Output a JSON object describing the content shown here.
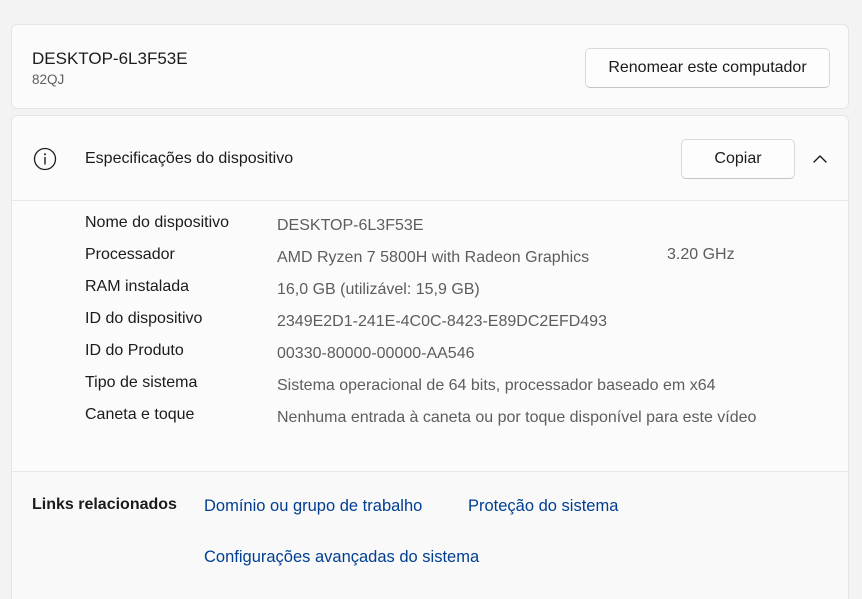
{
  "device": {
    "name": "DESKTOP-6L3F53E",
    "model": "82QJ",
    "rename_label": "Renomear este computador"
  },
  "specs": {
    "title": "Especificações do dispositivo",
    "copy_label": "Copiar",
    "expanded": true,
    "rows": [
      {
        "label": "Nome do dispositivo",
        "value": "DESKTOP-6L3F53E"
      },
      {
        "label": "Processador",
        "value": "AMD Ryzen 7 5800H with Radeon Graphics",
        "extra": "3.20 GHz"
      },
      {
        "label": "RAM instalada",
        "value": "16,0 GB (utilizável: 15,9 GB)"
      },
      {
        "label": "ID do dispositivo",
        "value": "2349E2D1-241E-4C0C-8423-E89DC2EFD493"
      },
      {
        "label": "ID do Produto",
        "value": "00330-80000-00000-AA546"
      },
      {
        "label": "Tipo de sistema",
        "value": "Sistema operacional de 64 bits, processador baseado em x64"
      },
      {
        "label": "Caneta e toque",
        "value": "Nenhuma entrada à caneta ou por toque disponível para este vídeo"
      }
    ]
  },
  "related_links": {
    "title": "Links relacionados",
    "links": [
      "Domínio ou grupo de trabalho",
      "Proteção do sistema",
      "Configurações avançadas do sistema"
    ]
  },
  "icons": {
    "info": "info-icon",
    "chevron": "chevron-up-icon"
  },
  "colors": {
    "link": "#003e92",
    "background": "#f3f3f3",
    "card": "#fbfbfb"
  }
}
